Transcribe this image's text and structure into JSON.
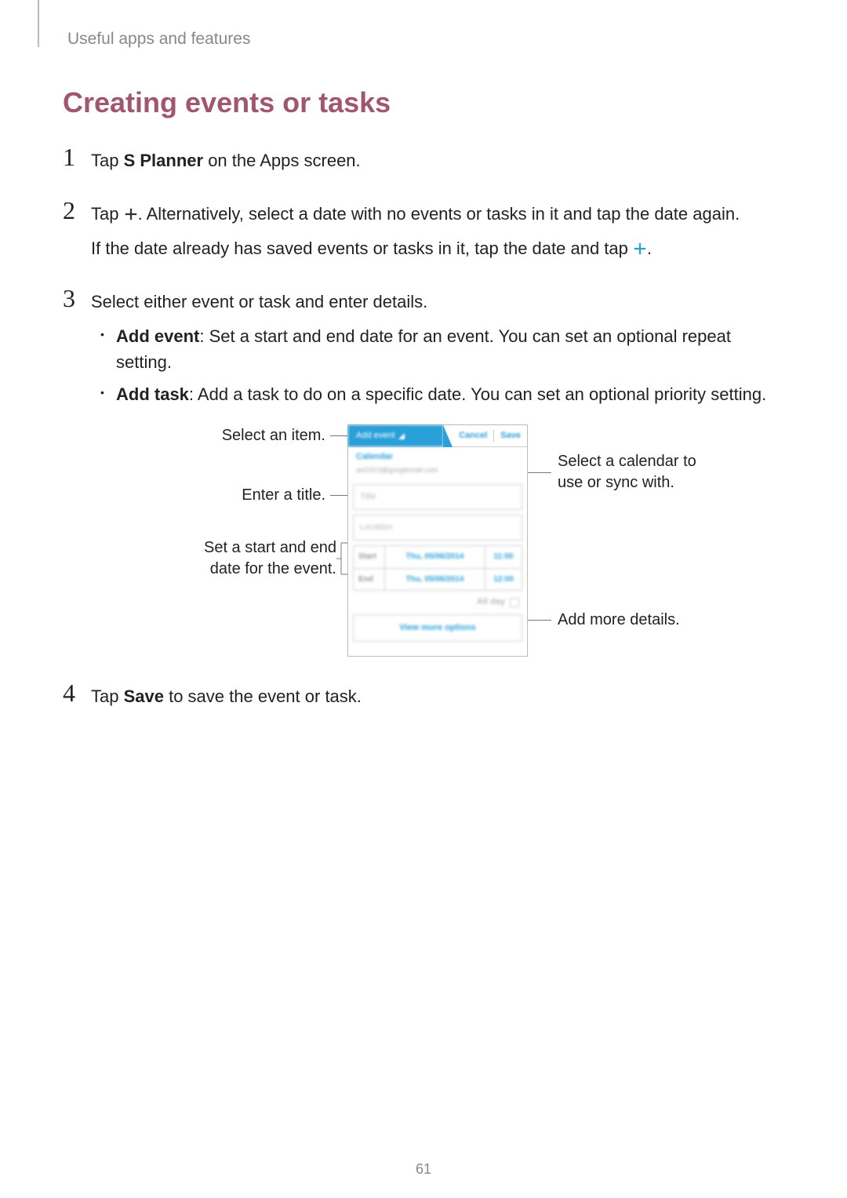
{
  "breadcrumb": "Useful apps and features",
  "heading": "Creating events or tasks",
  "steps": {
    "s1": {
      "num": "1",
      "prefix": "Tap ",
      "bold": "S Planner",
      "suffix": " on the Apps screen."
    },
    "s2": {
      "num": "2",
      "line1_a": "Tap ",
      "line1_b": ". Alternatively, select a date with no events or tasks in it and tap the date again.",
      "line2_a": "If the date already has saved events or tasks in it, tap the date and tap ",
      "line2_b": "."
    },
    "s3": {
      "num": "3",
      "intro": "Select either event or task and enter details.",
      "b1_bold": "Add event",
      "b1_rest": ": Set a start and end date for an event. You can set an optional repeat setting.",
      "b2_bold": "Add task",
      "b2_rest": ": Add a task to do on a specific date. You can set an optional priority setting."
    },
    "s4": {
      "num": "4",
      "prefix": "Tap ",
      "bold": "Save",
      "suffix": " to save the event or task."
    }
  },
  "callouts": {
    "left1": "Select an item.",
    "left2": "Enter a title.",
    "left3": "Set a start and end date for the event.",
    "right1": "Select a calendar to use or sync with.",
    "right2": "Add more details."
  },
  "phone": {
    "tab": "Add event",
    "cancel": "Cancel",
    "save": "Save",
    "calendar_label": "Calendar",
    "calendar_sub": "ani1413@googlemail.com",
    "title_ph": "Title",
    "location_ph": "Location",
    "start_lbl": "Start",
    "end_lbl": "End",
    "start_date": "Thu, 05/06/2014",
    "start_time": "11:00",
    "end_date": "Thu, 05/06/2014",
    "end_time": "12:00",
    "allday": "All day",
    "view_more": "View more options"
  },
  "page_number": "61"
}
